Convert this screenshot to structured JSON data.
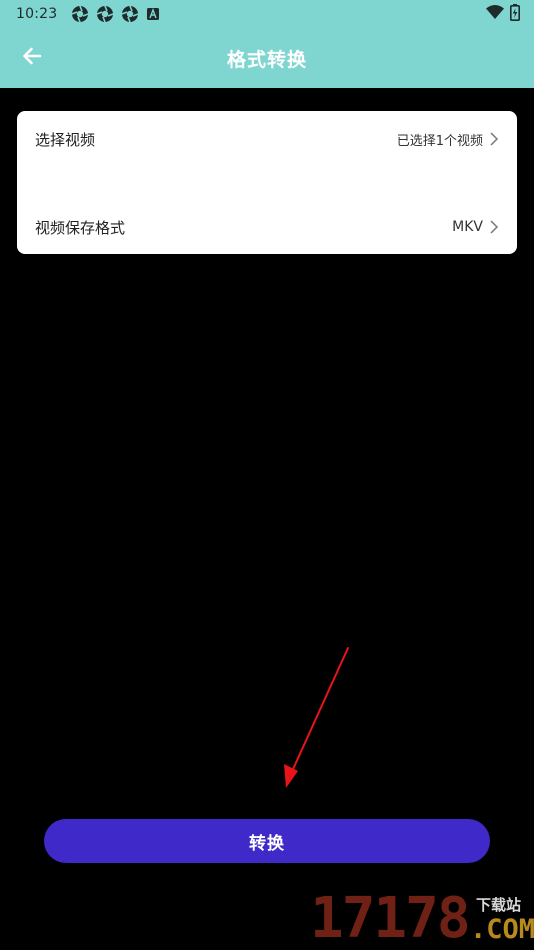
{
  "status_bar": {
    "time": "10:23",
    "notification_icons": [
      "aperture-icon",
      "aperture-icon",
      "aperture-icon",
      "text-a-icon"
    ],
    "right_icons": [
      "wifi-icon",
      "battery-icon"
    ]
  },
  "app_bar": {
    "back_icon": "arrow-left-icon",
    "title": "格式转换"
  },
  "settings": {
    "select_video": {
      "label": "选择视频",
      "value": "已选择1个视频"
    },
    "save_format": {
      "label": "视频保存格式",
      "value": "MKV"
    }
  },
  "action": {
    "convert_label": "转换"
  },
  "watermark": {
    "digits": "17178",
    "subtitle": "下载站",
    "domain": ".COM"
  },
  "colors": {
    "header_bg": "#7fd6d1",
    "button_bg": "#3f29c8",
    "annotation_arrow": "#e8141a"
  }
}
